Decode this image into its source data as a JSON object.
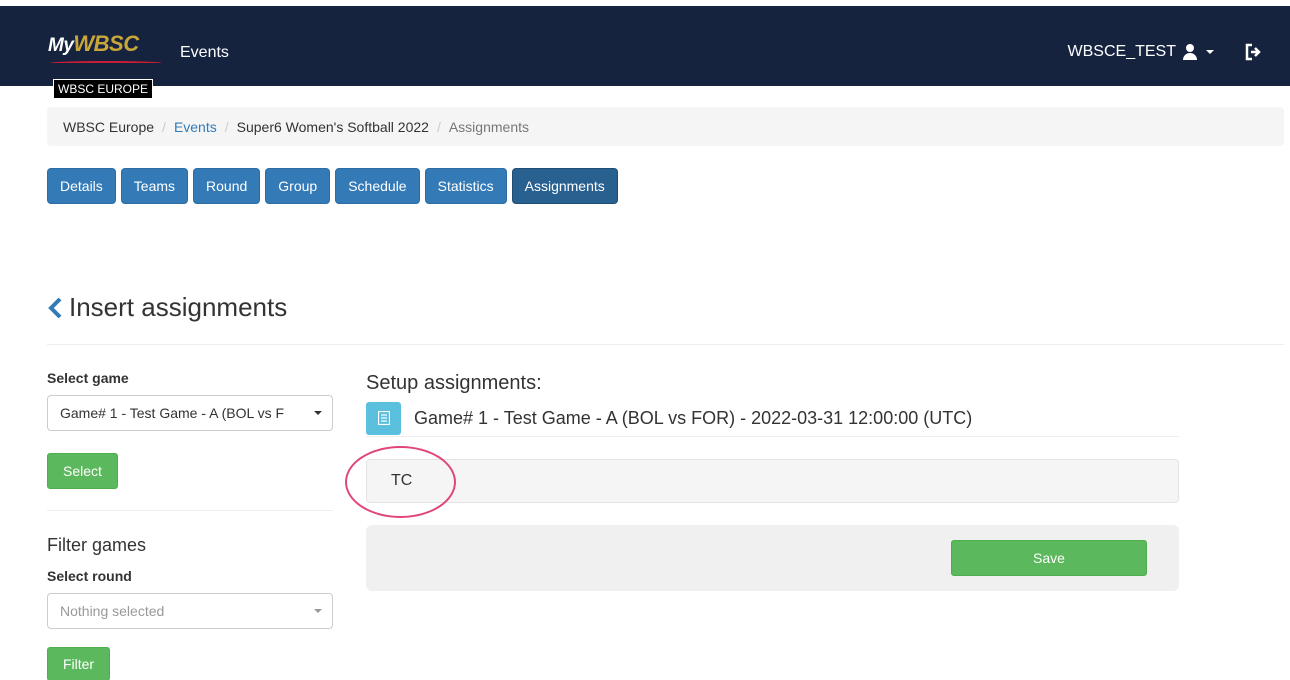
{
  "navbar": {
    "brand_my": "My",
    "brand_wbsc": "WBSC",
    "brand_badge": "WBSC EUROPE",
    "events_link": "Events",
    "username": "WBSCE_TEST"
  },
  "breadcrumb": {
    "items": [
      "WBSC Europe",
      "Events",
      "Super6 Women's Softball 2022",
      "Assignments"
    ]
  },
  "tabs": [
    "Details",
    "Teams",
    "Round",
    "Group",
    "Schedule",
    "Statistics",
    "Assignments"
  ],
  "active_tab": "Assignments",
  "page": {
    "title": "Insert assignments"
  },
  "left": {
    "select_game_label": "Select game",
    "select_game_value": "Game# 1 - Test Game - A (BOL vs F",
    "select_button": "Select",
    "filter_title": "Filter games",
    "select_round_label": "Select round",
    "select_round_placeholder": "Nothing selected",
    "filter_button": "Filter"
  },
  "right": {
    "setup_title": "Setup assignments:",
    "game_title": "Game# 1 - Test Game - A (BOL vs FOR) - 2022-03-31 12:00:00 (UTC)",
    "role_label": "TC",
    "save_button": "Save"
  },
  "colors": {
    "navbar_bg": "#15233f",
    "primary": "#337ab7",
    "primary_active": "#286090",
    "success": "#5cb85c",
    "info": "#5bc0de",
    "highlight": "#e0467c"
  }
}
